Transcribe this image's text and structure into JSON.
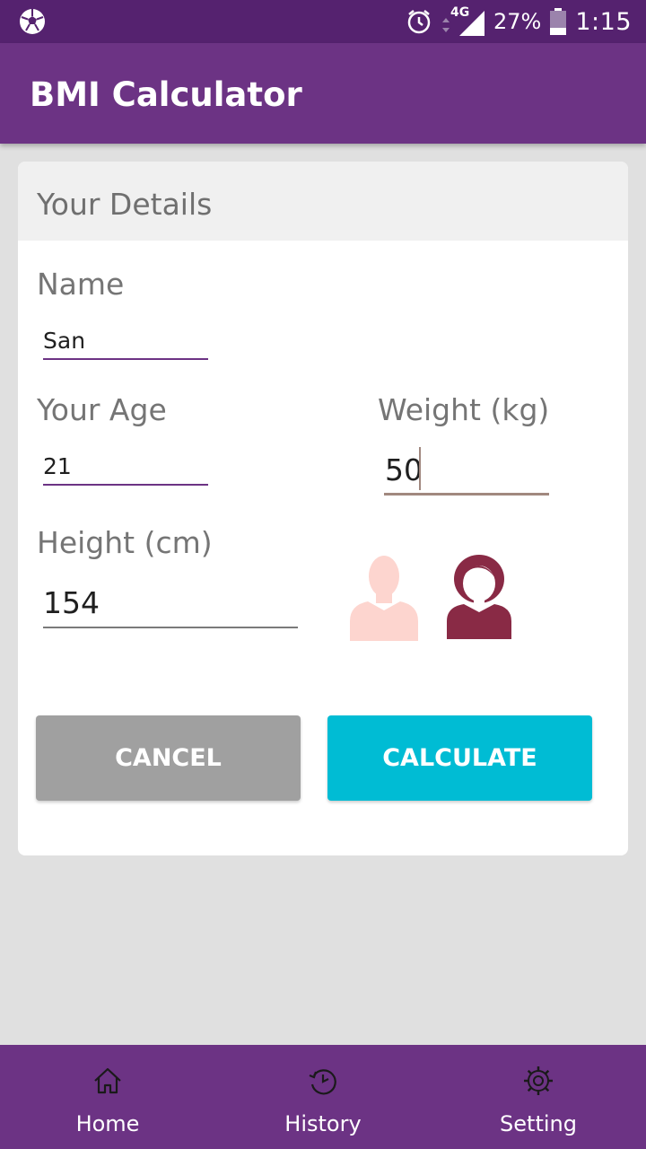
{
  "status_bar": {
    "network": "4G",
    "battery": "27%",
    "time": "1:15",
    "icons": [
      "soccer-ball-icon",
      "alarm-icon",
      "signal-icon",
      "battery-icon"
    ]
  },
  "app_bar": {
    "title": "BMI Calculator"
  },
  "card": {
    "header_title": "Your Details",
    "name": {
      "label": "Name",
      "value": "San"
    },
    "age": {
      "label": "Your Age",
      "value": "21"
    },
    "weight": {
      "label": "Weight (kg)",
      "value": "50"
    },
    "height": {
      "label": "Height (cm)",
      "value": "154"
    },
    "gender": {
      "options": [
        "male",
        "female"
      ],
      "selected": "female",
      "colors": {
        "male_inactive": "#fdd5cf",
        "female_active": "#892a45"
      }
    },
    "buttons": {
      "cancel": "CANCEL",
      "calculate": "CALCULATE"
    }
  },
  "bottom_nav": {
    "items": [
      {
        "label": "Home",
        "icon": "home-icon"
      },
      {
        "label": "History",
        "icon": "history-icon"
      },
      {
        "label": "Setting",
        "icon": "gear-icon"
      }
    ]
  },
  "colors": {
    "status_bar": "#55226f",
    "primary": "#6c3384",
    "cancel_button": "#a0a0a0",
    "calculate_button": "#00bcd4",
    "accent_underline": "#6c3384"
  }
}
